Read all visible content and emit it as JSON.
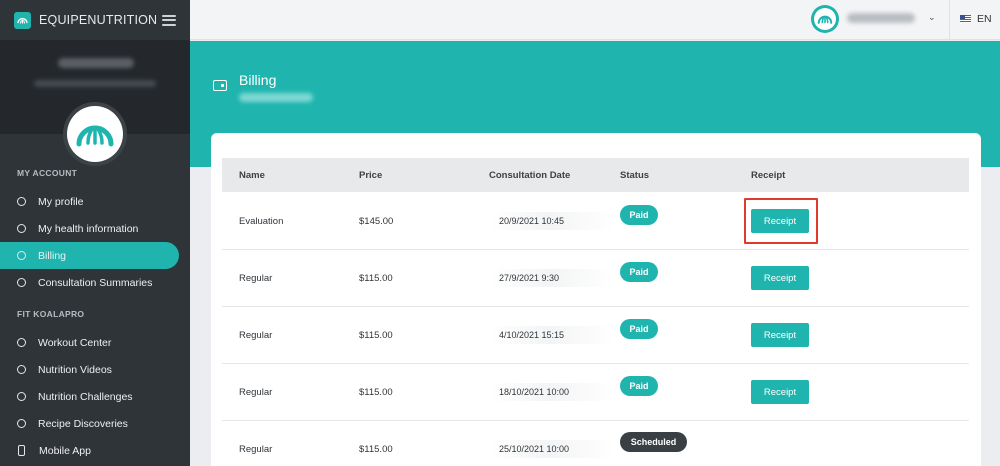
{
  "brand": {
    "name": "EQUIPENUTRITION"
  },
  "sidebar": {
    "sections": [
      {
        "label": "MY ACCOUNT"
      },
      {
        "label": "FIT KOALAPRO"
      }
    ],
    "items": [
      {
        "label": "My profile"
      },
      {
        "label": "My health information"
      },
      {
        "label": "Billing",
        "active": true
      },
      {
        "label": "Consultation Summaries"
      },
      {
        "label": "Workout Center"
      },
      {
        "label": "Nutrition Videos"
      },
      {
        "label": "Nutrition Challenges"
      },
      {
        "label": "Recipe Discoveries"
      },
      {
        "label": "Mobile App"
      }
    ]
  },
  "topbar": {
    "language": "EN"
  },
  "page": {
    "title": "Billing"
  },
  "table": {
    "headers": {
      "name": "Name",
      "price": "Price",
      "date": "Consultation Date",
      "status": "Status",
      "receipt": "Receipt"
    },
    "rows": [
      {
        "name": "Evaluation",
        "price": "$145.00",
        "date": "20/9/2021 10:45",
        "status": "Paid",
        "receipt": "Receipt"
      },
      {
        "name": "Regular",
        "price": "$115.00",
        "date": "27/9/2021 9:30",
        "status": "Paid",
        "receipt": "Receipt"
      },
      {
        "name": "Regular",
        "price": "$115.00",
        "date": "4/10/2021 15:15",
        "status": "Paid",
        "receipt": "Receipt"
      },
      {
        "name": "Regular",
        "price": "$115.00",
        "date": "18/10/2021 10:00",
        "status": "Paid",
        "receipt": "Receipt"
      },
      {
        "name": "Regular",
        "price": "$115.00",
        "date": "25/10/2021 10:00",
        "status": "Scheduled",
        "receipt": ""
      }
    ]
  },
  "colors": {
    "accent": "#1fb5ae",
    "sidebar": "#2f3439",
    "highlight": "#e03a2c",
    "scheduled": "#3a3f44"
  }
}
